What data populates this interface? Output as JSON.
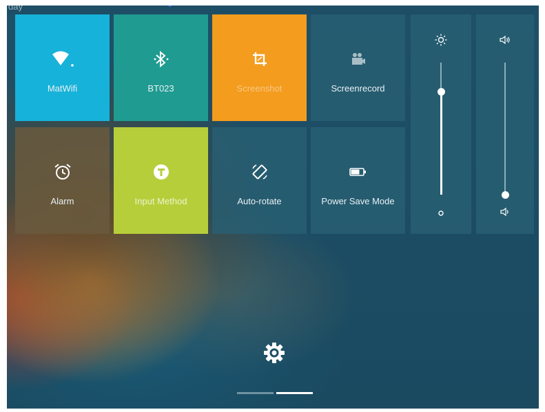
{
  "status_bar": {
    "fragment": "day"
  },
  "tiles": {
    "wifi": {
      "label": "MatWifi",
      "color": "#17b2d9",
      "icon": "wifi-icon"
    },
    "bluetooth": {
      "label": "BT023",
      "color": "#1f9b91",
      "icon": "bluetooth-icon"
    },
    "screenshot": {
      "label": "Screenshot",
      "color": "#f39c1e",
      "icon": "crop-icon"
    },
    "screenrecord": {
      "label": "Screenrecord",
      "color": "#2b5e73",
      "icon": "video-camera-icon"
    },
    "alarm": {
      "label": "Alarm",
      "color": "#6a5a3e",
      "icon": "alarm-clock-icon"
    },
    "input_method": {
      "label": "Input Method",
      "color": "#b7ce3b",
      "icon": "input-method-icon"
    },
    "auto_rotate": {
      "label": "Auto-rotate",
      "color": "#2b5e73",
      "icon": "screen-rotation-icon"
    },
    "power_save": {
      "label": "Power Save Mode",
      "color": "#2b5e73",
      "icon": "battery-icon"
    }
  },
  "brightness_slider": {
    "top_icon": "sun-icon",
    "bottom_icon": "small-circle-icon",
    "level": 0.78
  },
  "volume_slider": {
    "top_icon": "speaker-icon",
    "bottom_icon": "speaker-low-icon",
    "level": 0.0
  },
  "footer": {
    "settings_icon": "gear-icon",
    "pages": 2,
    "active_page": 2
  }
}
